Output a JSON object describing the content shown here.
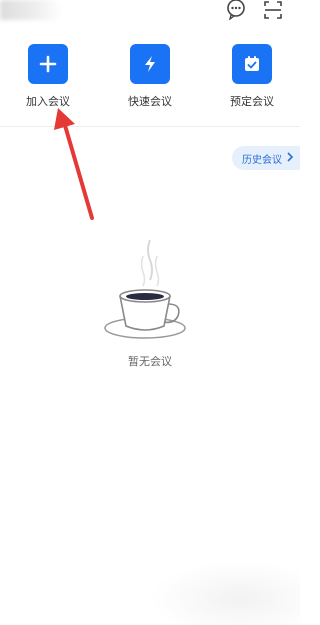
{
  "actions": [
    {
      "label": "加入会议",
      "icon": "plus-icon"
    },
    {
      "label": "快速会议",
      "icon": "lightning-icon"
    },
    {
      "label": "预定会议",
      "icon": "calendar-check-icon"
    }
  ],
  "history": {
    "label": "历史会议"
  },
  "empty": {
    "text": "暂无会议",
    "icon": "coffee-cup-icon"
  },
  "colors": {
    "accent": "#1a73f5",
    "arrow": "#e53935",
    "pill_bg": "#e6effc",
    "pill_text": "#2a6fd6"
  }
}
